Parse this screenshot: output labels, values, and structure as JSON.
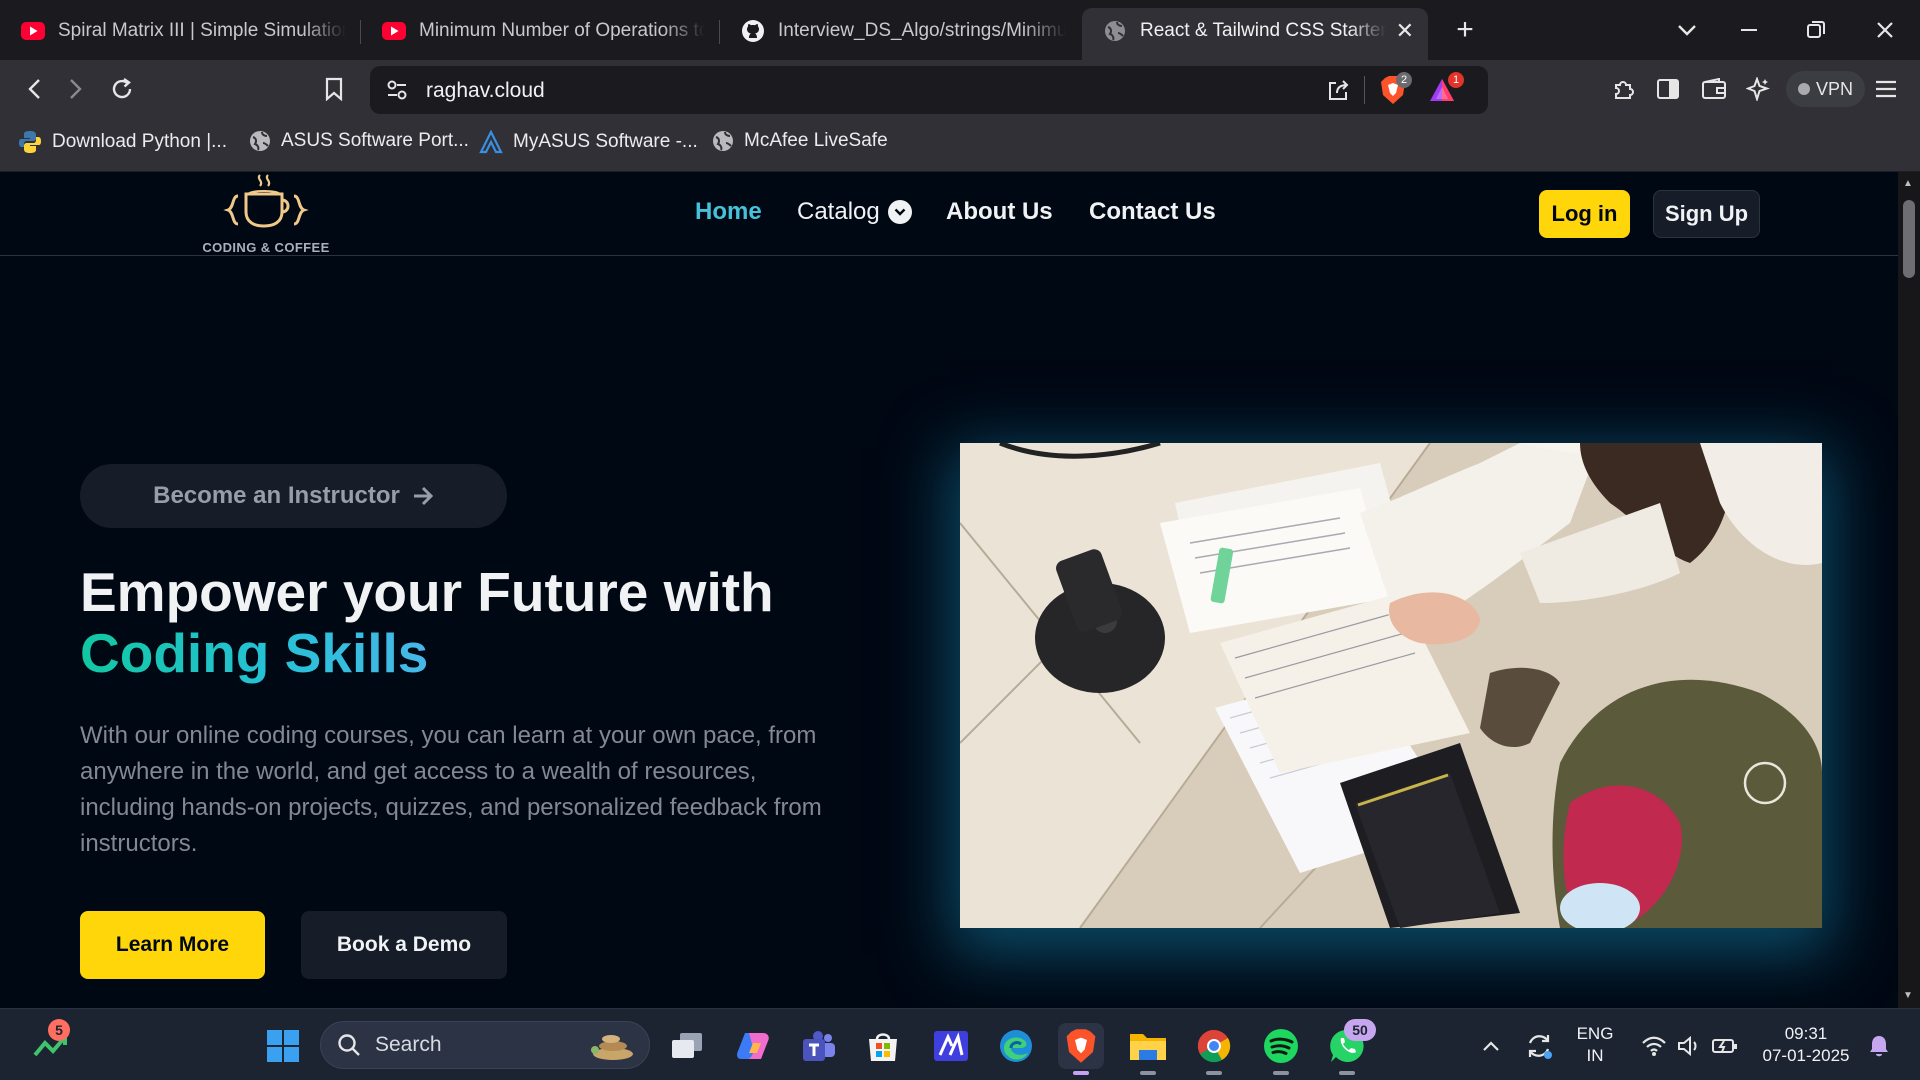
{
  "browser": {
    "tabs": [
      {
        "title": "Spiral Matrix III | Simple Simulation",
        "favicon": "youtube-icon"
      },
      {
        "title": "Minimum Number of Operations to",
        "favicon": "youtube-icon"
      },
      {
        "title": "Interview_DS_Algo/strings/Minimum",
        "favicon": "github-icon"
      },
      {
        "title": "React & Tailwind CSS Starter Pa",
        "favicon": "globe-icon",
        "active": true
      }
    ],
    "url": "raghav.cloud",
    "vpn_label": "VPN",
    "shield_badge": "2",
    "rewards_badge": "1",
    "bookmarks": [
      {
        "label": "Download Python |...",
        "icon": "python-icon"
      },
      {
        "label": "ASUS Software Port...",
        "icon": "globe-icon"
      },
      {
        "label": "MyASUS Software -...",
        "icon": "myasus-icon"
      },
      {
        "label": "McAfee LiveSafe",
        "icon": "globe-icon"
      }
    ]
  },
  "site": {
    "logo_text": "CODING & COFFEE",
    "nav": {
      "home": "Home",
      "catalog": "Catalog",
      "about": "About Us",
      "contact": "Contact Us"
    },
    "login_label": "Log in",
    "signup_label": "Sign Up",
    "hero": {
      "instructor_label": "Become an Instructor",
      "title_line1": "Empower your Future with",
      "title_highlight": "Coding Skills",
      "description": "With our online coding courses, you can learn at your own pace, from anywhere in the world, and get access to a wealth of resources, including hands-on projects, quizzes, and personalized feedback from instructors.",
      "learn_more": "Learn More",
      "book_demo": "Book a Demo"
    },
    "colors": {
      "accent_yellow": "#FFD60A",
      "background": "#000814",
      "highlight_start": "#12C7A2",
      "highlight_end": "#47B8E8"
    }
  },
  "taskbar": {
    "search_placeholder": "Search",
    "stocks_badge": "5",
    "whatsapp_badge": "50",
    "lang_line1": "ENG",
    "lang_line2": "IN",
    "time": "09:31",
    "date": "07-01-2025"
  }
}
